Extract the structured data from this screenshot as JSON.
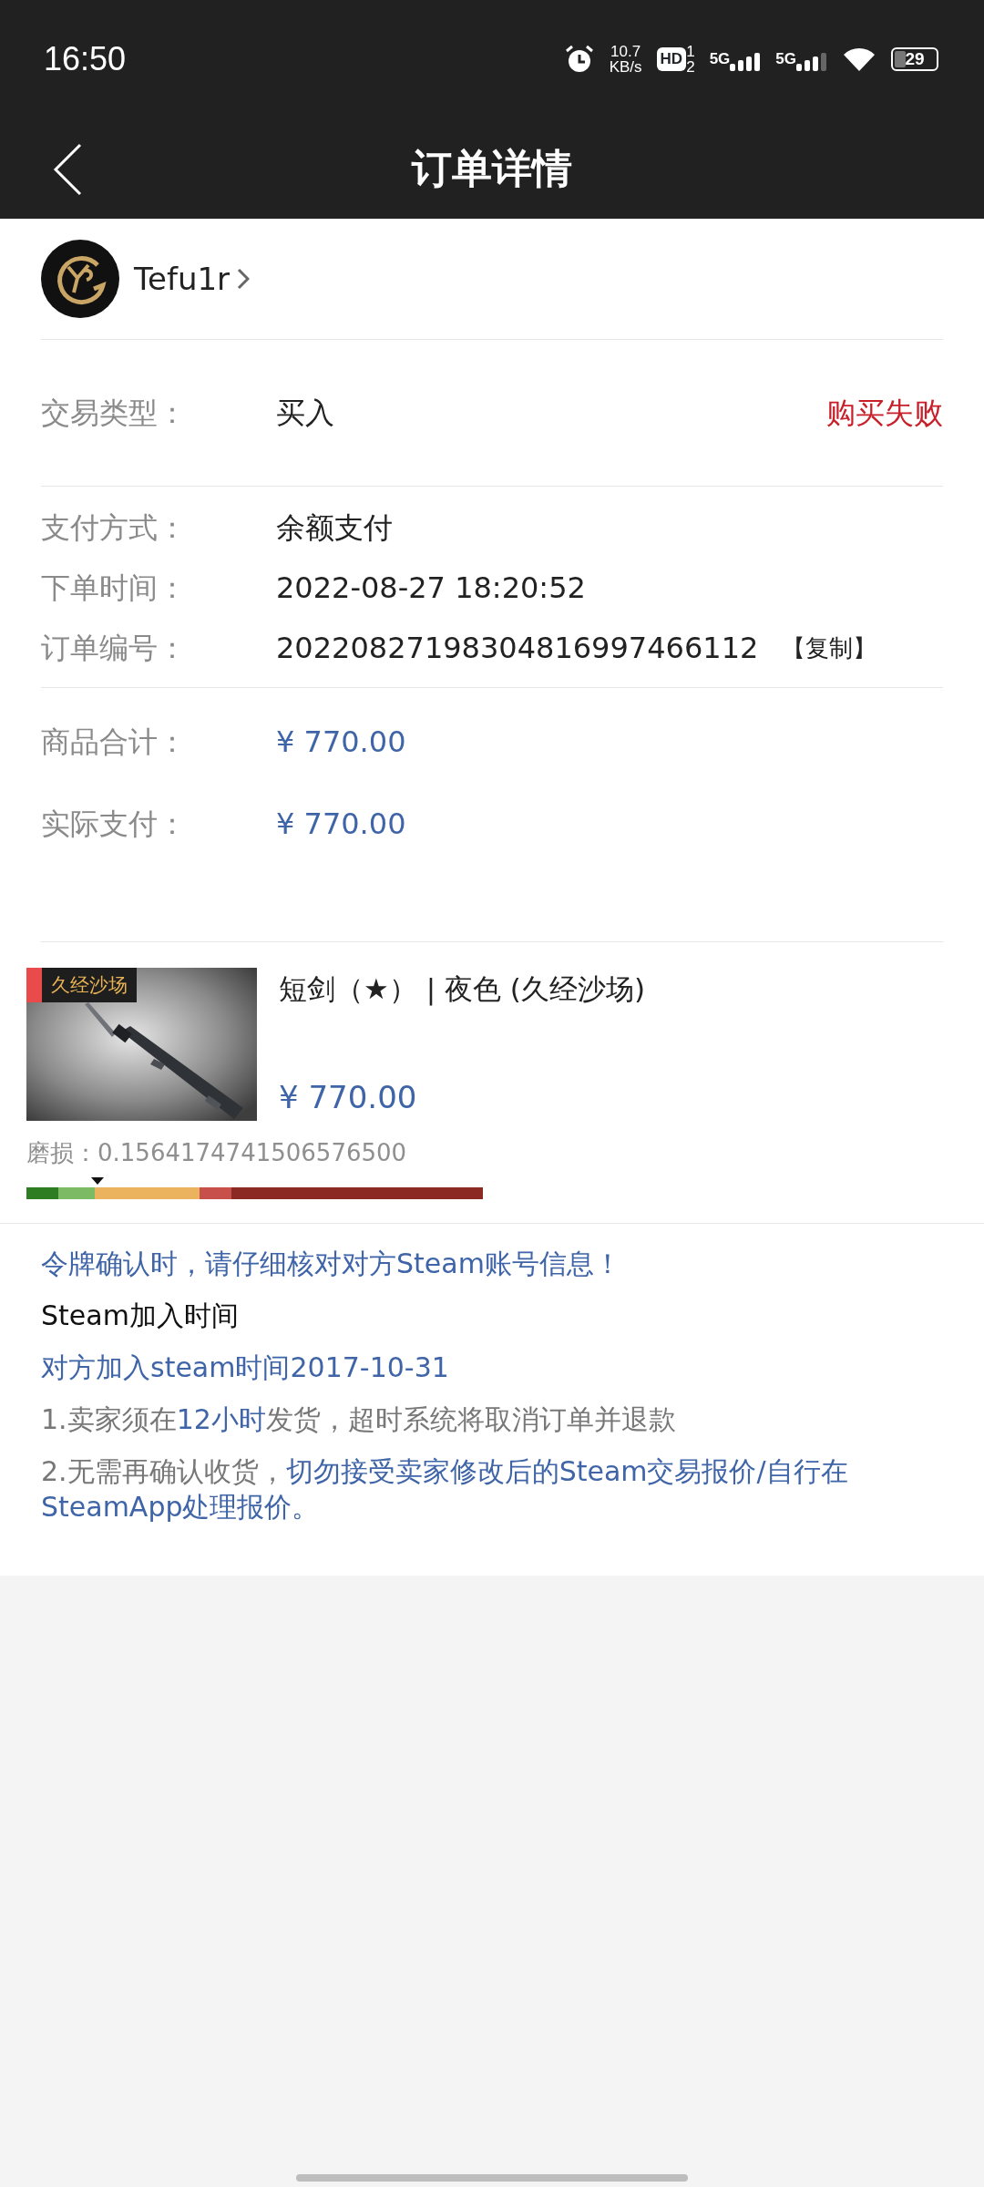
{
  "status_bar": {
    "time": "16:50",
    "speed_value": "10.7",
    "speed_unit": "KB/s",
    "hd": "HD",
    "sim_slots": [
      "1",
      "2"
    ],
    "networks": [
      {
        "label": "5G"
      },
      {
        "label": "5G"
      }
    ],
    "battery": "29"
  },
  "header": {
    "title": "订单详情"
  },
  "user": {
    "name": "Tefu1r"
  },
  "trade": {
    "label": "交易类型：",
    "value": "买入",
    "status": "购买失败"
  },
  "details": [
    {
      "label": "支付方式：",
      "value": "余额支付"
    },
    {
      "label": "下单时间：",
      "value": "2022-08-27  18:20:52"
    },
    {
      "label": "订单编号：",
      "value": "20220827198304816997466112",
      "action": "【复制】"
    }
  ],
  "totals": [
    {
      "label": "商品合计：",
      "value": "¥  770.00"
    },
    {
      "label": "实际支付：",
      "value": "¥  770.00"
    }
  ],
  "item": {
    "exterior": "久经沙场",
    "color": "#e94a4a",
    "title": "短剑（★） | 夜色 (久经沙场)",
    "price": "¥  770.00",
    "wear_label": "磨损：0.1564174741506576500",
    "wear": {
      "level": 0.156
    }
  },
  "notes": [
    {
      "parts": [
        {
          "text": "令牌确认时，请仔细核对对方Steam账号信息！",
          "kind": "emphasis"
        }
      ]
    },
    {
      "parts": [
        {
          "text": "Steam加入时间",
          "kind": "heading"
        }
      ]
    },
    {
      "parts": [
        {
          "text": "对方加入steam时间2017-10-31",
          "kind": "emphasis"
        }
      ]
    },
    {
      "parts": [
        {
          "text": "1.卖家须在",
          "kind": "plain"
        },
        {
          "text": "12小时",
          "kind": "emphasis"
        },
        {
          "text": "发货，超时系统将取消订单并退款",
          "kind": "plain"
        }
      ]
    },
    {
      "parts": [
        {
          "text": "2.无需再确认收货，",
          "kind": "plain"
        },
        {
          "text": "切勿接受卖家修改后的Steam交易报价/自行在SteamApp处理报价。",
          "kind": "emphasis"
        }
      ]
    }
  ]
}
